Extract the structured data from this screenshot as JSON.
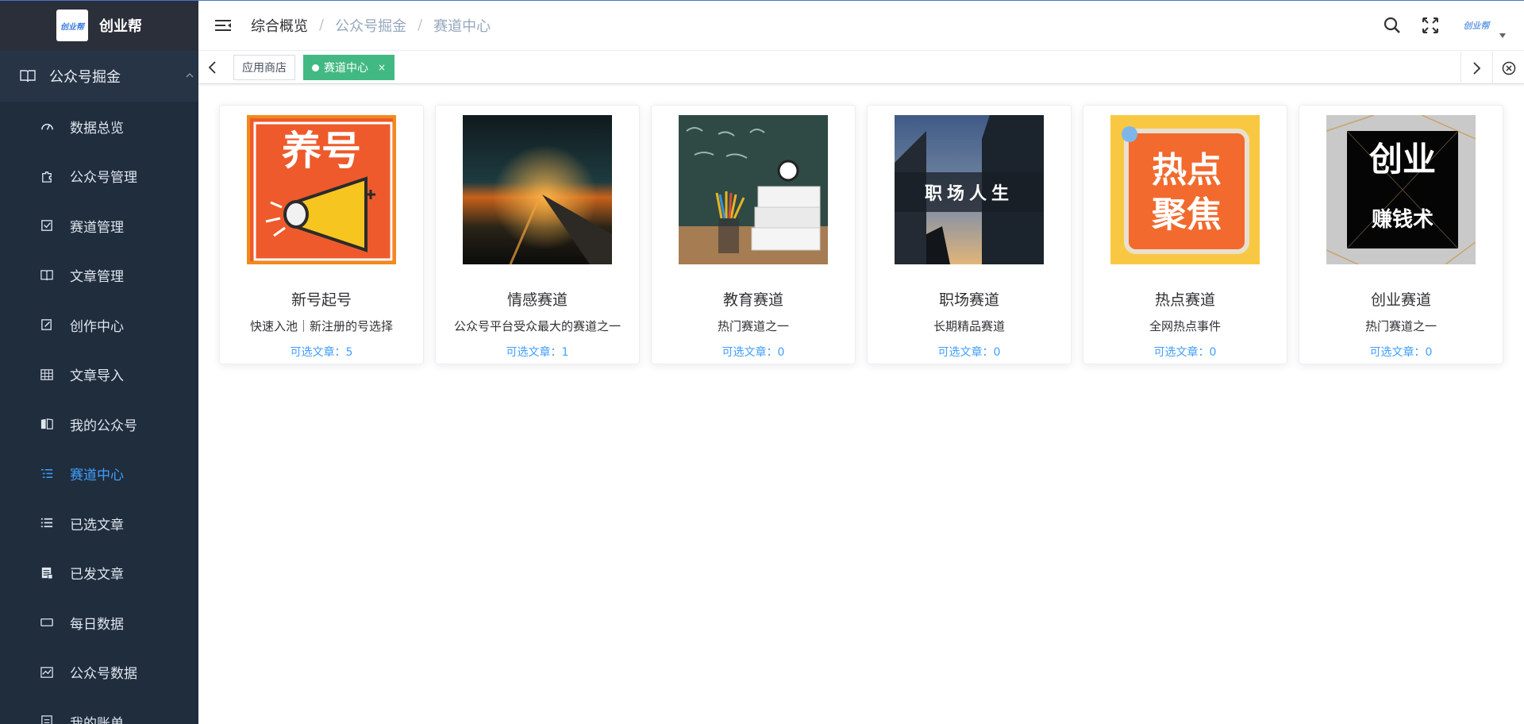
{
  "brand": {
    "logo_text": "创业帮",
    "title": "创业帮"
  },
  "sidebar": {
    "group": {
      "label": "公众号掘金",
      "icon": "book-icon",
      "expanded": true
    },
    "items": [
      {
        "label": "数据总览",
        "icon": "dashboard-icon",
        "active": false
      },
      {
        "label": "公众号管理",
        "icon": "plugin-icon",
        "active": false
      },
      {
        "label": "赛道管理",
        "icon": "checkbox-icon",
        "active": false
      },
      {
        "label": "文章管理",
        "icon": "book-icon",
        "active": false
      },
      {
        "label": "创作中心",
        "icon": "edit-icon",
        "active": false
      },
      {
        "label": "文章导入",
        "icon": "table-icon",
        "active": false
      },
      {
        "label": "我的公众号",
        "icon": "reader-icon",
        "active": false
      },
      {
        "label": "赛道中心",
        "icon": "list-tree-icon",
        "active": true
      },
      {
        "label": "已选文章",
        "icon": "list-icon",
        "active": false
      },
      {
        "label": "已发文章",
        "icon": "document-icon",
        "active": false
      },
      {
        "label": "每日数据",
        "icon": "card-icon",
        "active": false
      },
      {
        "label": "公众号数据",
        "icon": "chart-icon",
        "active": false
      },
      {
        "label": "我的账单",
        "icon": "bill-icon",
        "active": false
      }
    ]
  },
  "header": {
    "breadcrumb": [
      "综合概览",
      "公众号掘金",
      "赛道中心"
    ],
    "avatar_text": "创业帮"
  },
  "tags": [
    {
      "label": "应用商店",
      "active": false
    },
    {
      "label": "赛道中心",
      "active": true,
      "close": "×"
    }
  ],
  "cards": [
    {
      "title": "新号起号",
      "desc": "快速入池｜新注册的号选择",
      "count_label": "可选文章：",
      "count": 5,
      "image_text": "养号",
      "image": "megaphone-poster"
    },
    {
      "title": "情感赛道",
      "desc": "公众号平台受众最大的赛道之一",
      "count_label": "可选文章：",
      "count": 1,
      "image_text": "",
      "image": "night-road-photo"
    },
    {
      "title": "教育赛道",
      "desc": "热门赛道之一",
      "count_label": "可选文章：",
      "count": 0,
      "image_text": "",
      "image": "classroom-books-photo"
    },
    {
      "title": "职场赛道",
      "desc": "长期精品赛道",
      "count_label": "可选文章：",
      "count": 0,
      "image_text": "职场人生",
      "image": "city-buildings-photo"
    },
    {
      "title": "热点赛道",
      "desc": "全网热点事件",
      "count_label": "可选文章：",
      "count": 0,
      "image_text": "热点聚焦",
      "image": "hot-topic-poster"
    },
    {
      "title": "创业赛道",
      "desc": "热门赛道之一",
      "count_label": "可选文章：",
      "count": 0,
      "image_text": "创业 赚钱术",
      "image_text_line1": "创业",
      "image_text_line2": "赚钱术",
      "image": "startup-poster"
    }
  ],
  "colors": {
    "sidebar_bg": "#1f2d3d",
    "active_menu": "#409eff",
    "active_tag": "#42b983",
    "count_text": "#409eff"
  }
}
